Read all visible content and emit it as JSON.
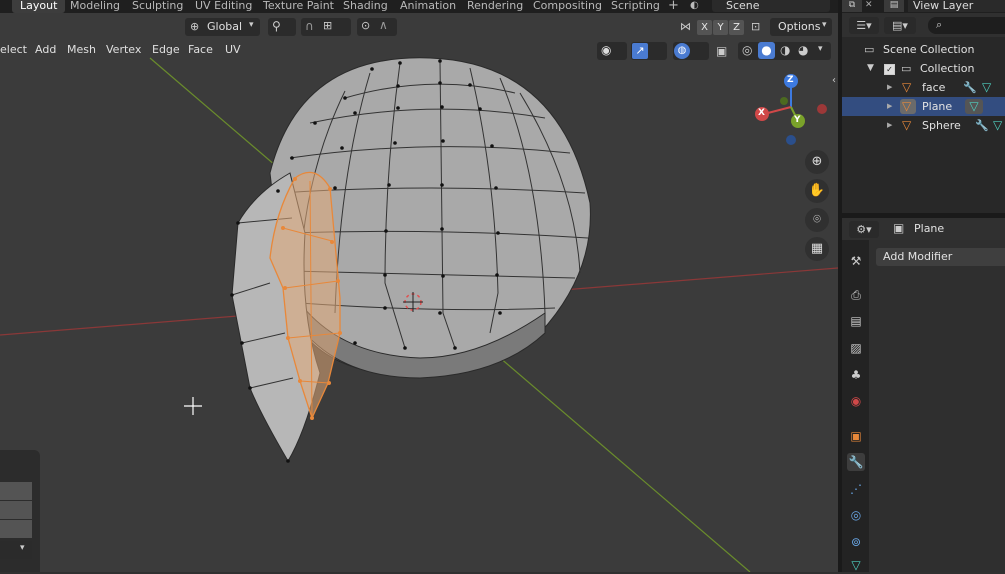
{
  "workspace_tabs": [
    {
      "label": "Layout",
      "active": true
    },
    {
      "label": "Modeling",
      "active": false
    },
    {
      "label": "Sculpting",
      "active": false
    },
    {
      "label": "UV Editing",
      "active": false
    },
    {
      "label": "Texture Paint",
      "active": false
    },
    {
      "label": "Shading",
      "active": false
    },
    {
      "label": "Animation",
      "active": false
    },
    {
      "label": "Rendering",
      "active": false
    },
    {
      "label": "Compositing",
      "active": false
    },
    {
      "label": "Scripting",
      "active": false
    }
  ],
  "add_workspace": "+",
  "scene": {
    "label": "Scene"
  },
  "view_layer": {
    "label": "View Layer"
  },
  "viewport_header": {
    "transform_orientation": "Global",
    "axes": [
      "X",
      "Y",
      "Z"
    ],
    "options_label": "Options",
    "menus": [
      "elect",
      "Add",
      "Mesh",
      "Vertex",
      "Edge",
      "Face",
      "UV"
    ]
  },
  "gizmo": {
    "x": "X",
    "y": "Y",
    "z": "Z"
  },
  "outliner": {
    "scene_collection": "Scene Collection",
    "collection": "Collection",
    "objects": [
      {
        "name": "face",
        "selected": false
      },
      {
        "name": "Plane",
        "selected": true
      },
      {
        "name": "Sphere",
        "selected": false
      }
    ]
  },
  "properties": {
    "object_name": "Plane",
    "add_modifier": "Add Modifier"
  },
  "colors": {
    "selection": "#e8883a",
    "active_tab": "#4a7bd1",
    "mesh": "#c8c8c8",
    "x_axis": "#d04848",
    "y_axis": "#7aa22a",
    "z_axis": "#3d7ae0"
  }
}
